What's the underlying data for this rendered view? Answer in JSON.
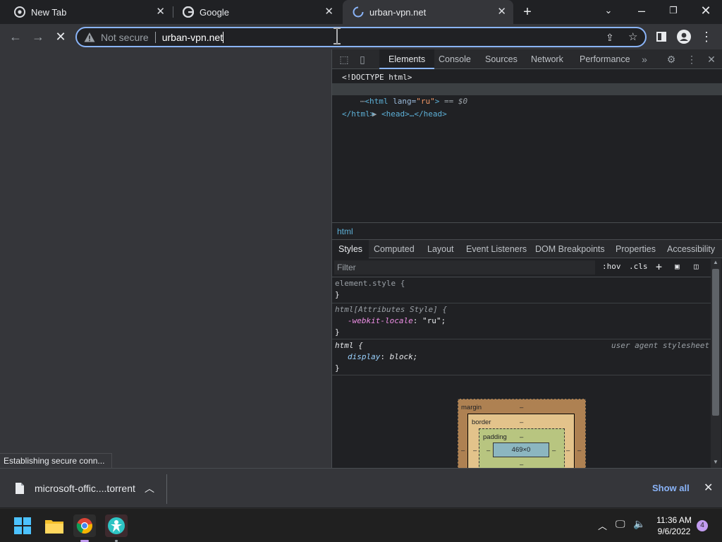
{
  "tabs": [
    {
      "title": "New Tab",
      "favicon": "chrome-icon"
    },
    {
      "title": "Google",
      "favicon": "google-icon"
    },
    {
      "title": "urban-vpn.net",
      "favicon": "loading-spinner-icon"
    }
  ],
  "omnibox": {
    "security": "Not secure",
    "url": "urban-vpn.net"
  },
  "status_bubble": "Establishing secure conn...",
  "devtools": {
    "tabs": [
      "Elements",
      "Console",
      "Sources",
      "Network",
      "Performance"
    ],
    "dom": {
      "doctype": "<!DOCTYPE html>",
      "html_open_tag": "html",
      "lang_attr": "lang",
      "lang_value": "\"ru\"",
      "selected_marker": "== $0",
      "head": "<head>…</head>",
      "html_close": "</html>"
    },
    "breadcrumb": "html",
    "style_tabs": [
      "Styles",
      "Computed",
      "Layout",
      "Event Listeners",
      "DOM Breakpoints",
      "Properties",
      "Accessibility"
    ],
    "filter_placeholder": "Filter",
    "hov": ":hov",
    "cls": ".cls",
    "rules": {
      "r1_selector": "element.style {",
      "r1_close": "}",
      "r2_selector": "html[Attributes Style] {",
      "r2_prop": "-webkit-locale",
      "r2_value": "\"ru\";",
      "r2_close": "}",
      "r3_selector": "html {",
      "r3_source": "user agent stylesheet",
      "r3_prop": "display",
      "r3_value": "block;",
      "r3_close": "}"
    },
    "boxmodel": {
      "margin": "margin",
      "border": "border",
      "padding": "padding",
      "content": "469×0",
      "dash": "–"
    }
  },
  "download": {
    "filename": "microsoft-offic....torrent",
    "show_all": "Show all"
  },
  "taskbar": {
    "time": "11:36 AM",
    "date": "9/6/2022",
    "notifications": "4"
  }
}
